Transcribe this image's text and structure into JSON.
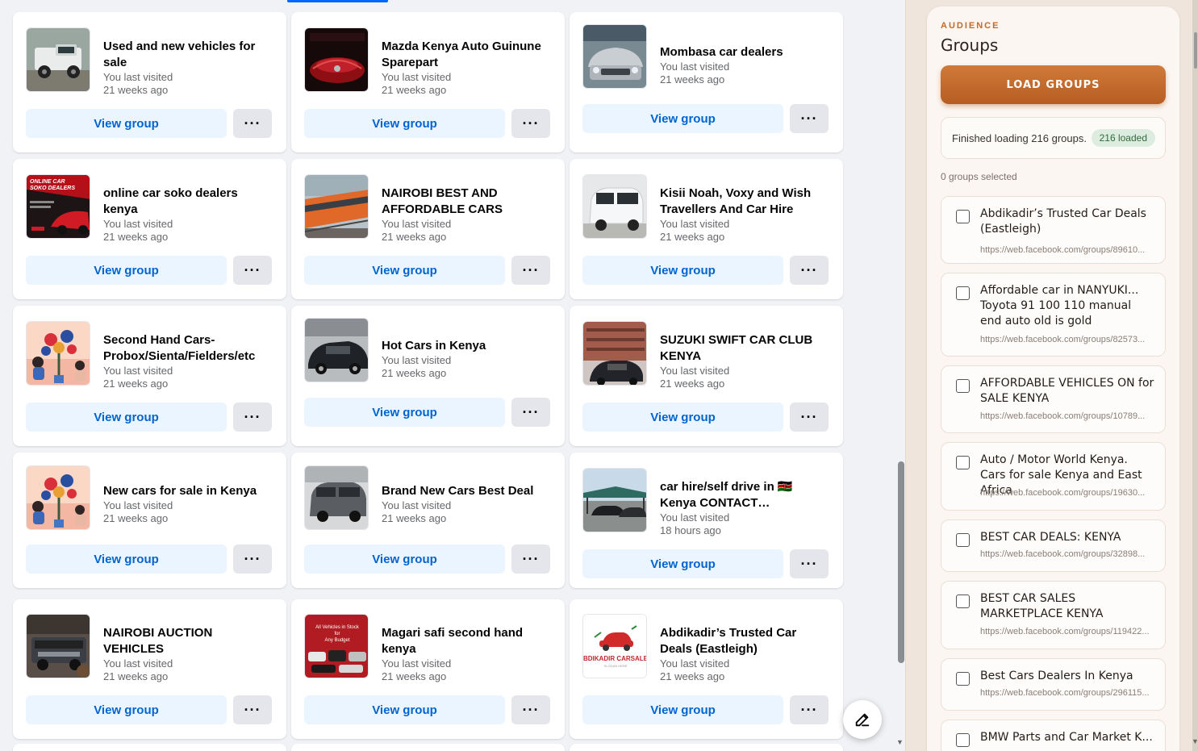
{
  "groups_grid": {
    "view_label": "View group",
    "more_label": "···",
    "cards": [
      {
        "name": "Used and new vehicles for sale",
        "visited_label": "You last visited",
        "visited_ago": "21 weeks ago",
        "thumb": "white-pickup"
      },
      {
        "name": "Mazda Kenya Auto Guinune Sparepart",
        "visited_label": "You last visited",
        "visited_ago": "21 weeks ago",
        "thumb": "red-mazda"
      },
      {
        "name": "Mombasa car dealers",
        "visited_label": "You last visited",
        "visited_ago": "21 weeks ago",
        "thumb": "silver-sedan"
      },
      {
        "name": "online car soko dealers kenya",
        "visited_label": "You last visited",
        "visited_ago": "21 weeks ago",
        "thumb": "soko-poster",
        "thumb_text": "ONLINE CAR SOKO DEALERS"
      },
      {
        "name": "NAIROBI BEST AND AFFORDABLE CARS",
        "visited_label": "You last visited",
        "visited_ago": "21 weeks ago",
        "thumb": "orange-train"
      },
      {
        "name": "Kisii Noah, Voxy and Wish Travellers And Car Hire",
        "visited_label": "You last visited",
        "visited_ago": "21 weeks ago",
        "thumb": "white-van"
      },
      {
        "name": "Second Hand Cars-Probox/Sienta/Fielders/etc",
        "visited_label": "You last visited",
        "visited_ago": "21 weeks ago",
        "thumb": "flower-illustration"
      },
      {
        "name": "Hot Cars in Kenya",
        "visited_label": "You last visited",
        "visited_ago": "21 weeks ago",
        "thumb": "black-sedan"
      },
      {
        "name": "SUZUKI SWIFT CAR CLUB KENYA",
        "visited_label": "You last visited",
        "visited_ago": "21 weeks ago",
        "thumb": "parking-building"
      },
      {
        "name": "New cars for sale in Kenya",
        "visited_label": "You last visited",
        "visited_ago": "21 weeks ago",
        "thumb": "flower-illustration"
      },
      {
        "name": "Brand New Cars Best Deal",
        "visited_label": "You last visited",
        "visited_ago": "21 weeks ago",
        "thumb": "grey-minivan"
      },
      {
        "name": "car hire/self drive in 🇰🇪 Kenya CONTACT…",
        "visited_label": "You last visited",
        "visited_ago": "18 hours ago",
        "thumb": "car-shade"
      },
      {
        "name": "NAIROBI AUCTION VEHICLES",
        "visited_label": "You last visited",
        "visited_ago": "21 weeks ago",
        "thumb": "range-rover"
      },
      {
        "name": "Magari safi second hand kenya",
        "visited_label": "You last visited",
        "visited_ago": "21 weeks ago",
        "thumb": "red-poster",
        "thumb_text": "All Vehicles in Stock for Any Budget"
      },
      {
        "name": "Abdikadir’s Trusted Car Deals (Eastleigh)",
        "visited_label": "You last visited",
        "visited_ago": "21 weeks ago",
        "thumb": "carsale-logo",
        "thumb_text": "BDIKADIR CARSALE",
        "thumb_subtext": "SLOGAN HERE"
      }
    ]
  },
  "panel": {
    "eyebrow": "AUDIENCE",
    "title": "Groups",
    "load_button": "LOAD GROUPS",
    "status_text": "Finished loading 216 groups.",
    "status_badge": "216 loaded",
    "selected_count": "0 groups selected",
    "items": [
      {
        "title": "Abdikadir’s Trusted Car Deals (Eastleigh)",
        "url": "https://web.facebook.com/groups/89610..."
      },
      {
        "title": "Affordable car in NANYUKI... Toyota 91 100 110 manual end auto old is gold",
        "url": "https://web.facebook.com/groups/82573..."
      },
      {
        "title": "AFFORDABLE VEHICLES ON for SALE KENYA",
        "url": "https://web.facebook.com/groups/10789..."
      },
      {
        "title": "Auto / Motor World Kenya. Cars for sale Kenya and East Africa",
        "url": "https://web.facebook.com/groups/19630..."
      },
      {
        "title": "BEST CAR DEALS: KENYA",
        "url": "https://web.facebook.com/groups/32898..."
      },
      {
        "title": "BEST CAR SALES MARKETPLACE KENYA",
        "url": "https://web.facebook.com/groups/119422..."
      },
      {
        "title": "Best Cars Dealers In Kenya",
        "url": "https://web.facebook.com/groups/296115..."
      },
      {
        "title": "BMW Parts and Car Market K...",
        "url": ""
      }
    ]
  },
  "colors": {
    "fb_blue": "#0064d1",
    "view_bg": "#ebf5ff",
    "accent_orange": "#c06a2b",
    "badge_green": "#2f6b3d"
  }
}
